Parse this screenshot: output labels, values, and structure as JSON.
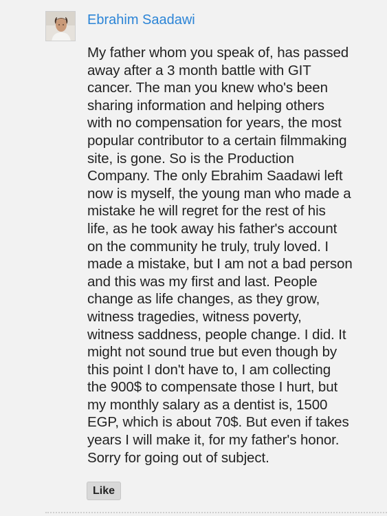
{
  "comment": {
    "author": "Ebrahim Saadawi",
    "avatar_icon": "user-photo-icon",
    "text_lines": [
      "My father whom you speak of, has passed",
      "away after a 3 month battle with GIT",
      "cancer. The man you knew who's been",
      "sharing information and helping others",
      "with no compensation for years, the most",
      "popular contributor to a certain filmmaking",
      "site, is gone. So is the Production",
      "Company. The only Ebrahim Saadawi left",
      "now is myself, the young man who made a",
      "mistake he will regret for the rest of his",
      "life, as he took away his father's account",
      "on the community he truly, truly loved. I",
      "made a mistake, but I am not a bad person",
      "and this was my first and last. People",
      "change as life changes, as they grow,",
      "witness tragedies, witness poverty,",
      "witness saddness, people change. I did. It",
      "might not sound true but even though by",
      "this point I don't have to, I am collecting",
      "the 900$ to compensate those I hurt, but",
      "my monthly salary as a dentist is, 1500",
      "EGP, which is about 70$. But even if takes",
      "years I will make it, for my father's honor.",
      "Sorry for going out of subject."
    ],
    "like_label": "Like"
  },
  "colors": {
    "background": "#f2f2f2",
    "author_link": "#2b84d6",
    "text": "#222222",
    "like_button_bg": "#d8d8d8"
  }
}
